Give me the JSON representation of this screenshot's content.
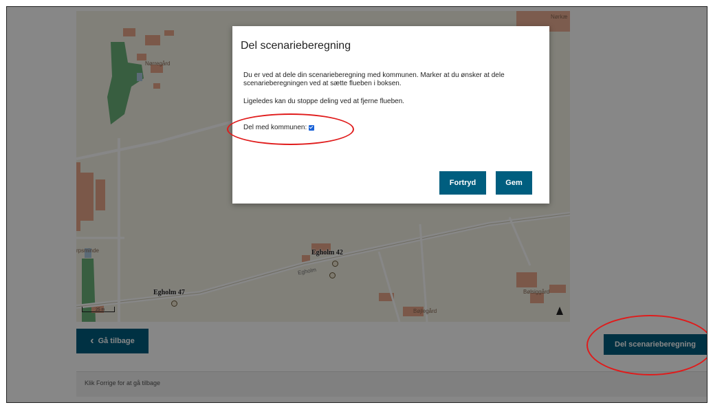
{
  "map": {
    "places": [
      "Nørregård",
      "Nørkæ",
      "rpsminde",
      "Bøjlegård",
      "Bølsiggård"
    ],
    "road_label": "Egholm",
    "addresses": [
      "Egholm 42",
      "Egholm 47"
    ],
    "scale_label": "25 m"
  },
  "modal": {
    "title": "Del scenarieberegning",
    "paragraph1": "Du er ved at dele din scenarieberegning med kommunen. Marker at du ønsker at dele scenarieberegningen ved at sætte flueben i boksen.",
    "paragraph2": "Ligeledes kan du stoppe deling ved at fjerne flueben.",
    "checkbox_label": "Del med kommunen:",
    "checkbox_checked": true,
    "cancel_label": "Fortryd",
    "save_label": "Gem"
  },
  "page": {
    "back_label": "Gå tilbage",
    "share_label": "Del scenarieberegning",
    "footer_hint": "Klik Forrige for at gå tilbage"
  },
  "colors": {
    "primary": "#005e7f",
    "annotation": "#e01b1b",
    "checkbox": "#1b63d8"
  },
  "icons": {
    "back": "chevron-left-icon",
    "north": "north-arrow-icon",
    "address": "house-marker-icon"
  }
}
